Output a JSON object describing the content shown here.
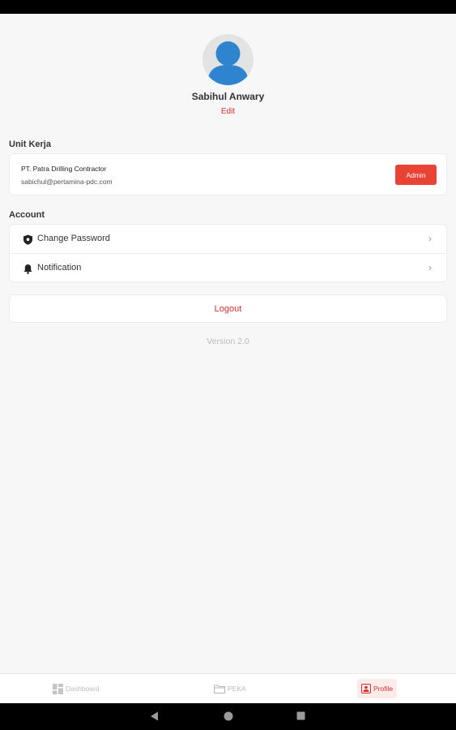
{
  "profile": {
    "name": "Sabihul Anwary",
    "edit_label": "Edit"
  },
  "unit_kerja": {
    "title": "Unit Kerja",
    "company": "PT. Patra Drilling Contractor",
    "email": "sabichul@pertamina-pdc.com",
    "role": "Admin"
  },
  "account": {
    "title": "Account",
    "items": [
      {
        "label": "Change Password",
        "icon": "shield-icon"
      },
      {
        "label": "Notification",
        "icon": "bell-icon"
      }
    ]
  },
  "logout_label": "Logout",
  "version": "Version 2.0",
  "bottom_nav": {
    "items": [
      {
        "label": "Dashboard",
        "icon": "dashboard-icon",
        "active": false
      },
      {
        "label": "PEKA",
        "icon": "folder-icon",
        "active": false
      },
      {
        "label": "Profile",
        "icon": "profile-icon",
        "active": true
      }
    ]
  },
  "colors": {
    "accent": "#d32f2f",
    "badge": "#e84335",
    "avatar_blue": "#2f84d0"
  }
}
